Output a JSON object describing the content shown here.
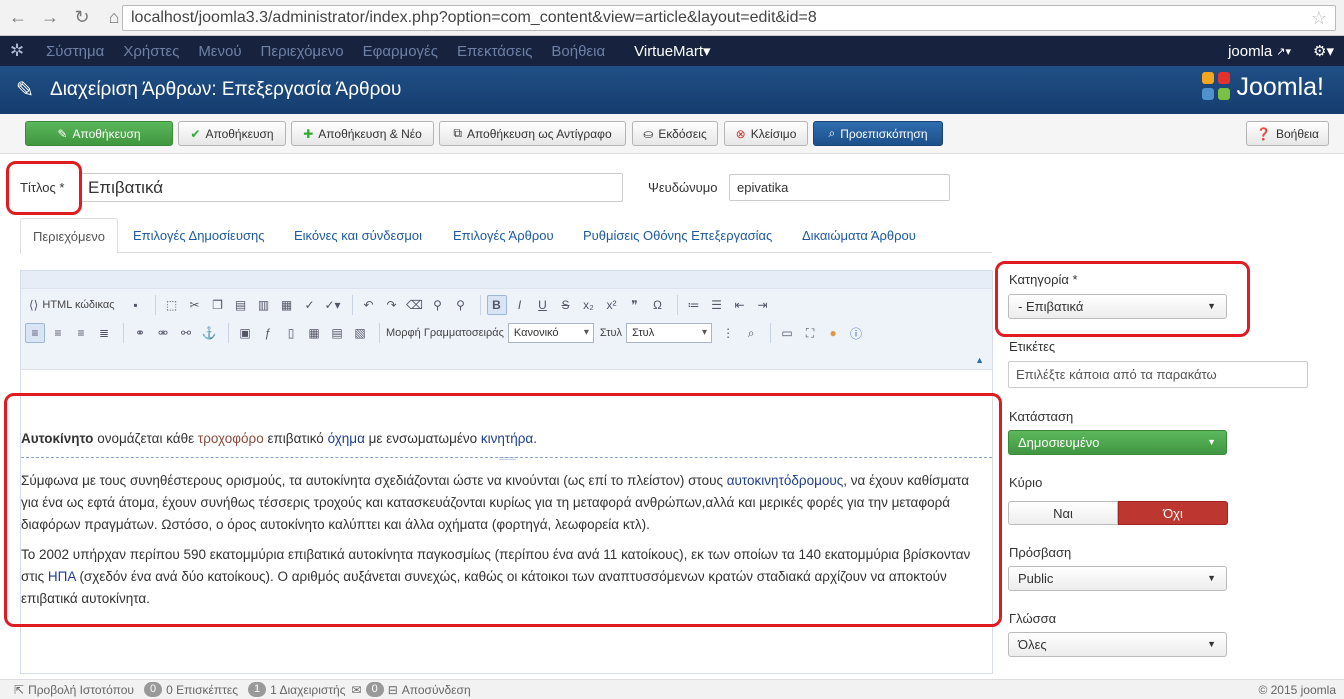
{
  "browser": {
    "url": "localhost/joomla3.3/administrator/index.php?option=com_content&view=article&layout=edit&id=8"
  },
  "admin_nav": {
    "items": [
      "Σύστημα",
      "Χρήστες",
      "Μενού",
      "Περιεχόμενο",
      "Εφαρμογές",
      "Επεκτάσεις",
      "Βοήθεια"
    ],
    "virtuemart": "VirtueMart▾",
    "user": "joomla",
    "gear": "⚙▾"
  },
  "header": {
    "title": "Διαχείριση Άρθρων: Επεξεργασία Άρθρου",
    "logo": "Joomla!"
  },
  "toolbar": {
    "save": "Αποθήκευση",
    "save_close": "Αποθήκευση",
    "save_new": "Αποθήκευση & Νέο",
    "save_copy": "Αποθήκευση ως Αντίγραφο",
    "versions": "Εκδόσεις",
    "close": "Κλείσιμο",
    "preview": "Προεπισκόπηση",
    "help": "Βοήθεια"
  },
  "form": {
    "title_label": "Τίτλος *",
    "title_value": "Επιβατικά",
    "alias_label": "Ψευδώνυμο",
    "alias_value": "epivatika"
  },
  "tabs": [
    "Περιεχόμενο",
    "Επιλογές Δημοσίευσης",
    "Εικόνες και σύνδεσμοι",
    "Επιλογές Άρθρου",
    "Ρυθμίσεις Οθόνης Επεξεργασίας",
    "Δικαιώματα Άρθρου"
  ],
  "editor": {
    "html_label": "HTML κώδικας",
    "font_format_label": "Μορφή Γραμματοσειράς",
    "font_format_value": "Κανονικό",
    "style_label": "Στυλ",
    "style_value": "Στυλ",
    "p1_bold": "Αυτοκίνητο",
    "p1_a": " ονομάζεται κάθε ",
    "p1_link1": "τροχοφόρο",
    "p1_b": " επιβατικό ",
    "p1_link2": "όχημα",
    "p1_c": " με ενσωματωμένο ",
    "p1_link3": "κινητήρα",
    "p1_d": ".",
    "p2_a": " Σύμφωνα με τους συνηθέστερους ορισμούς, τα αυτοκίνητα σχεδιάζονται ώστε να κινούνται (ως επί το πλείστον) στους ",
    "p2_link": "αυτοκινητόδρομους",
    "p2_b": ", να έχουν καθίσματα για ένα ως εφτά άτομα, έχουν συνήθως τέσσερις τροχούς και κατασκευάζονται κυρίως για τη μεταφορά ανθρώπων,αλλά και μερικές φορές για την μεταφορά διαφόρων πραγμάτων. Ωστόσο, ο όρος αυτοκίνητο καλύπτει και άλλα οχήματα (φορτηγά, λεωφορεία κτλ).",
    "p3_a": "Το 2002 υπήρχαν περίπου 590 εκατομμύρια επιβατικά αυτοκίνητα παγκοσμίως (περίπου ένα ανά 11 κατοίκους), εκ των οποίων τα 140 εκατομμύρια βρίσκονταν στις ",
    "p3_link": "ΗΠΑ",
    "p3_b": " (σχεδόν ένα ανά δύο κατοίκους). Ο αριθμός αυξάνεται συνεχώς, καθώς οι κάτοικοι των αναπτυσσόμενων κρατών σταδιακά αρχίζουν να αποκτούν επιβατικά αυτοκίνητα."
  },
  "sidebar": {
    "category_label": "Κατηγορία *",
    "category_value": "- Επιβατικά",
    "tags_label": "Ετικέτες",
    "tags_placeholder": "Επιλέξτε κάποια από τα παρακάτω",
    "status_label": "Κατάσταση",
    "status_value": "Δημοσιευμένο",
    "featured_label": "Κύριο",
    "featured_yes": "Ναι",
    "featured_no": "Όχι",
    "access_label": "Πρόσβαση",
    "access_value": "Public",
    "language_label": "Γλώσσα",
    "language_value": "Όλες"
  },
  "statusbar": {
    "view_site": "Προβολή Ιστοτόπου",
    "visitors_count": "0",
    "visitors_label": "0 Επισκέπτες",
    "admins_count": "1",
    "admins_label": "1 Διαχειριστής",
    "messages_count": "0",
    "logout": "Αποσύνδεση",
    "copyright": "© 2015 joomla"
  },
  "colors": {
    "navbar": "#17233e",
    "header": "#1f4f86",
    "save_green": "#46a546",
    "preview_blue": "#2a65a8",
    "highlight_red": "#e01b22"
  }
}
